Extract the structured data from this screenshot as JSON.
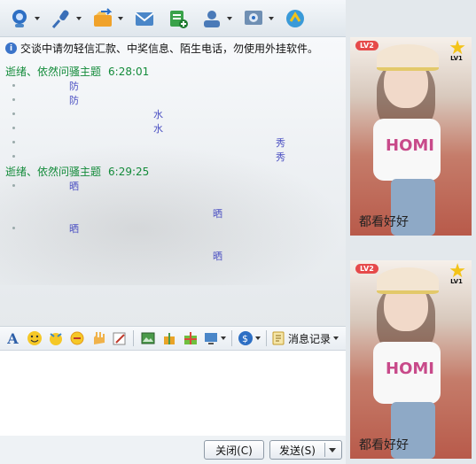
{
  "toolbar": {
    "items": [
      {
        "icon": "webcam-icon",
        "color": "#2d6fc4"
      },
      {
        "icon": "microphone-icon",
        "color": "#3a6fb8"
      },
      {
        "icon": "folder-send-icon",
        "color": "#f0a22a"
      },
      {
        "icon": "email-icon",
        "color": "#4a86c8"
      },
      {
        "icon": "add-group-icon",
        "color": "#3aa24a"
      },
      {
        "icon": "contact-card-icon",
        "color": "#4a7ab8"
      },
      {
        "icon": "settings-icon",
        "color": "#2d6fc4"
      },
      {
        "icon": "app-icon",
        "color": "#3a9ad8"
      }
    ]
  },
  "notice": {
    "text": "交谈中请勿轻信汇款、中奖信息、陌生电话，勿使用外挂软件。"
  },
  "messages": [
    {
      "sender": "逝绪、依然问骚主题",
      "time": "6:28:01",
      "lines": [
        "防",
        "防",
        "水",
        "水",
        "秀",
        "秀"
      ]
    },
    {
      "sender": "逝绪、依然问骚主题",
      "time": "6:29:25",
      "lines": [
        "晒",
        "晒",
        "晒",
        "晒"
      ]
    }
  ],
  "format_toolbar": {
    "items": [
      "font-icon",
      "emoji-icon",
      "magic-face-icon",
      "shake-icon",
      "hand-icon",
      "edit-icon",
      "screenshot-icon",
      "gift-box-icon",
      "gift-icon",
      "screen-share-icon",
      "payment-icon"
    ],
    "history_label": "消息记录"
  },
  "buttons": {
    "close_label": "关闭(C)",
    "send_label": "发送(S)"
  },
  "right_panel": {
    "photo1": {
      "badge": "LV2",
      "level": "LV1",
      "shirt_text": "HOMI",
      "caption": "都看好好"
    },
    "photo2": {
      "badge": "LV2",
      "level": "LV1",
      "shirt_text": "HOMI",
      "caption": "都看好好"
    }
  },
  "colors": {
    "sender": "#138b3a",
    "message_text": "#4a4fc2",
    "accent": "#2d6fc4"
  }
}
